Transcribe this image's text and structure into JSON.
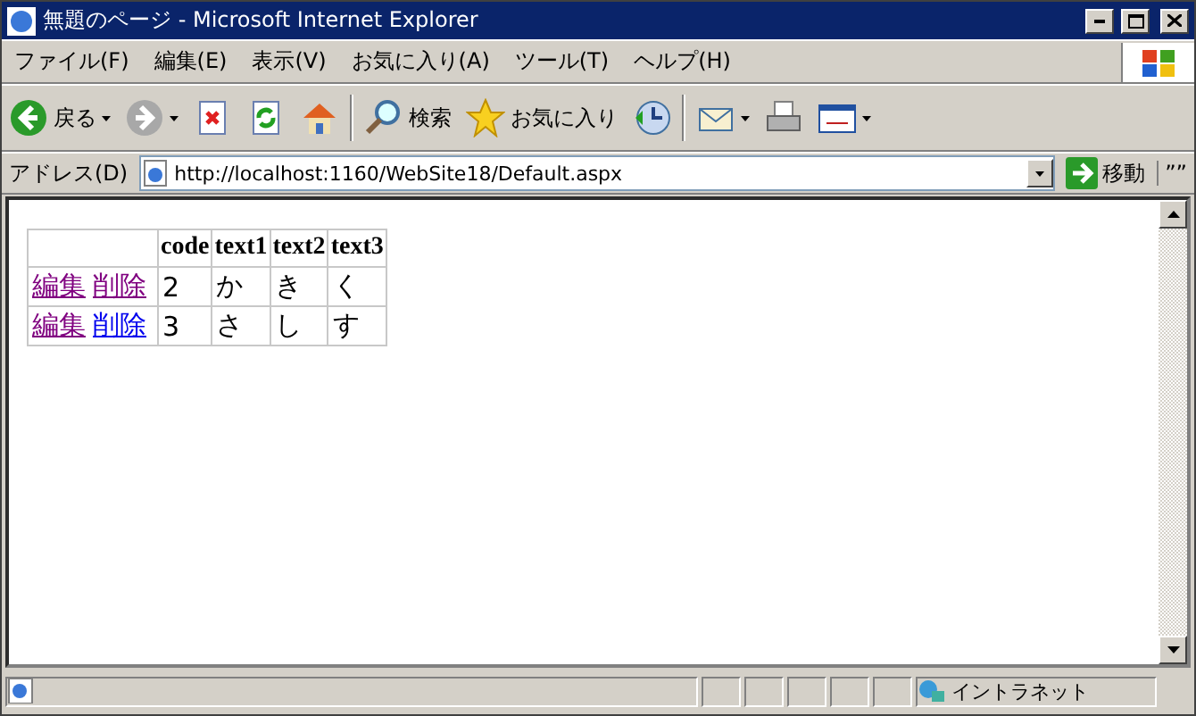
{
  "window": {
    "title": "無題のページ - Microsoft Internet Explorer"
  },
  "menu": [
    "ファイル(F)",
    "編集(E)",
    "表示(V)",
    "お気に入り(A)",
    "ツール(T)",
    "ヘルプ(H)"
  ],
  "toolbar": [
    {
      "kind": "back",
      "label": "戻る",
      "disabled": false
    },
    {
      "kind": "forward",
      "disabled": true
    },
    {
      "kind": "stop"
    },
    {
      "kind": "refresh"
    },
    {
      "kind": "home"
    },
    {
      "kind": "search",
      "label": "検索"
    },
    {
      "kind": "favorites",
      "label": "お気に入り"
    },
    {
      "kind": "history"
    },
    {
      "kind": "mail"
    },
    {
      "kind": "print"
    },
    {
      "kind": "edit"
    }
  ],
  "address": {
    "label": "アドレス(D)",
    "value": "http://localhost:1160/WebSite18/Default.aspx",
    "go": "移動",
    "links": "””"
  },
  "table": {
    "columns": [
      "",
      "code",
      "text1",
      "text2",
      "text3"
    ],
    "rows": [
      {
        "cells": [
          {
            "links": [
              {
                "label": "編集",
                "visited": true
              },
              {
                "label": "削除",
                "visited": true
              }
            ]
          },
          "2",
          "か",
          "き",
          "く"
        ]
      },
      {
        "cells": [
          {
            "links": [
              {
                "label": "編集",
                "visited": true
              },
              {
                "label": "削除",
                "visited": false
              }
            ]
          },
          "3",
          "さ",
          "し",
          "す"
        ]
      }
    ]
  },
  "status_bar": {
    "zone": "イントラネット"
  }
}
